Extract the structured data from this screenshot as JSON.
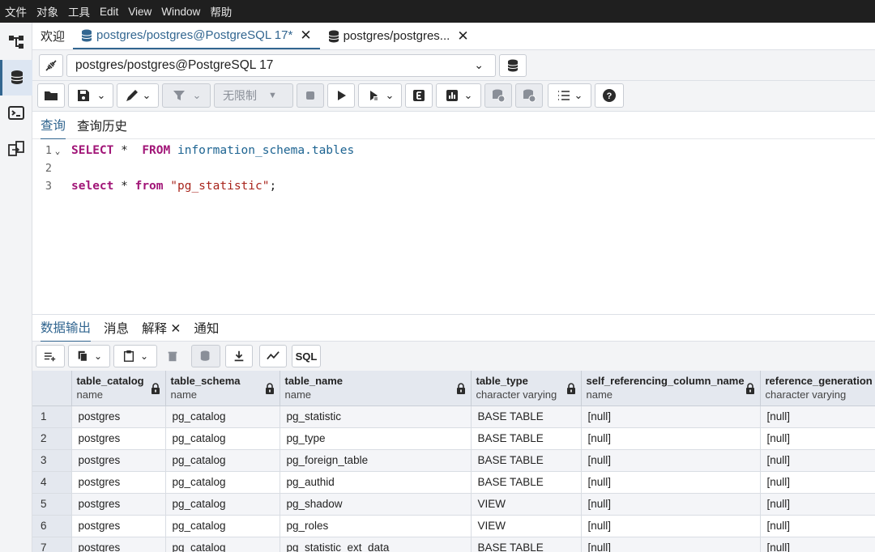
{
  "menu": [
    "文件",
    "对象",
    "工具",
    "Edit",
    "View",
    "Window",
    "帮助"
  ],
  "tabs": {
    "welcome": "欢迎",
    "query_tab": "postgres/postgres@PostgreSQL 17*",
    "second_tab": "postgres/postgres..."
  },
  "connection": {
    "selected": "postgres/postgres@PostgreSQL 17"
  },
  "toolbar": {
    "limit_label": "无限制"
  },
  "query_tabs": [
    "查询",
    "查询历史"
  ],
  "editor": {
    "lines": [
      {
        "num": "1"
      },
      {
        "num": "2"
      },
      {
        "num": "3"
      }
    ],
    "line1": {
      "kw1": "SELECT",
      "star": " *  ",
      "kw2": "FROM",
      "space": " ",
      "ident": "information_schema.tables"
    },
    "line3": {
      "kw1": "select",
      "star": " * ",
      "kw2": "from",
      "space": " ",
      "str": "\"pg_statistic\"",
      "semi": ";"
    }
  },
  "output_tabs": {
    "data": "数据输出",
    "messages": "消息",
    "explain": "解释",
    "notify": "通知"
  },
  "data_toolbar": {
    "sql_label": "SQL"
  },
  "grid": {
    "columns": [
      {
        "name": "table_catalog",
        "type": "name"
      },
      {
        "name": "table_schema",
        "type": "name"
      },
      {
        "name": "table_name",
        "type": "name"
      },
      {
        "name": "table_type",
        "type": "character varying"
      },
      {
        "name": "self_referencing_column_name",
        "type": "name"
      },
      {
        "name": "reference_generation",
        "type": "character varying"
      }
    ],
    "rows": [
      {
        "n": "1",
        "c": [
          "postgres",
          "pg_catalog",
          "pg_statistic",
          "BASE TABLE",
          "[null]",
          "[null]"
        ]
      },
      {
        "n": "2",
        "c": [
          "postgres",
          "pg_catalog",
          "pg_type",
          "BASE TABLE",
          "[null]",
          "[null]"
        ]
      },
      {
        "n": "3",
        "c": [
          "postgres",
          "pg_catalog",
          "pg_foreign_table",
          "BASE TABLE",
          "[null]",
          "[null]"
        ]
      },
      {
        "n": "4",
        "c": [
          "postgres",
          "pg_catalog",
          "pg_authid",
          "BASE TABLE",
          "[null]",
          "[null]"
        ]
      },
      {
        "n": "5",
        "c": [
          "postgres",
          "pg_catalog",
          "pg_shadow",
          "VIEW",
          "[null]",
          "[null]"
        ]
      },
      {
        "n": "6",
        "c": [
          "postgres",
          "pg_catalog",
          "pg_roles",
          "VIEW",
          "[null]",
          "[null]"
        ]
      },
      {
        "n": "7",
        "c": [
          "postgres",
          "pg_catalog",
          "pg_statistic_ext_data",
          "BASE TABLE",
          "[null]",
          "[null]"
        ]
      }
    ]
  },
  "colors": {
    "accent": "#326690",
    "menubar_bg": "#1f1f1f",
    "keyword": "#a11577",
    "string": "#a8241c",
    "identifier": "#1c6391"
  }
}
